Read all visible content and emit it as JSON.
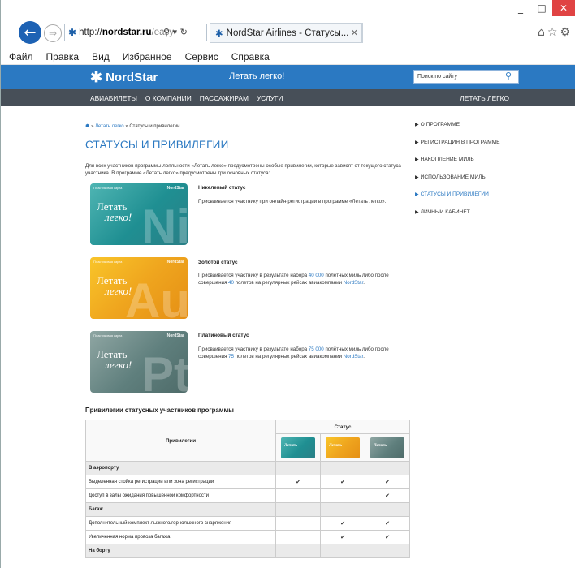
{
  "browser": {
    "url_prefix": "http://",
    "url_domain": "nordstar.ru",
    "url_rest": "/easy-",
    "tab_title": "NordStar Airlines - Статусы...",
    "window_controls": [
      "_",
      "□",
      "✕"
    ]
  },
  "menubar": [
    "Файл",
    "Правка",
    "Вид",
    "Избранное",
    "Сервис",
    "Справка"
  ],
  "header": {
    "logo": "NordStar",
    "slogan": "Летать легко!",
    "search_placeholder": "Поиск по сайту"
  },
  "nav": {
    "items": [
      "АВИАБИЛЕТЫ",
      "О КОМПАНИИ",
      "ПАССАЖИРАМ",
      "УСЛУГИ"
    ],
    "right": "ЛЕТАТЬ ЛЕГКО"
  },
  "breadcrumbs": {
    "sep": "»",
    "link": "Летать легко",
    "current": "Статусы и привилегии"
  },
  "title": "СТАТУСЫ И ПРИВИЛЕГИИ",
  "intro": "Для всех участников программы лояльности «Летать легко» предусмотрены особые привилегии, которые зависят от текущего статуса участника. В программе «Летать легко» предусмотрены три основных статуса:",
  "card_header": {
    "left": "Пластиковая карта",
    "brand": "NordStar",
    "site": "www.nordstar.ru"
  },
  "card_text": {
    "line1": "Летать",
    "line2": "легко!"
  },
  "statuses": [
    {
      "name": "Никелевый статус",
      "letters": "Ni",
      "desc_pre": "Присваивается участнику при онлайн-регистрации в программе «Летать легко».",
      "miles": "",
      "desc_mid": "",
      "flights": "",
      "desc_post": ""
    },
    {
      "name": "Золотой статус",
      "letters": "Au",
      "desc_pre": "Присваивается участнику в результате набора ",
      "miles": "40 000",
      "desc_mid": " полётных миль либо после совершения ",
      "flights": "40",
      "desc_post": " полетов на регулярных рейсах авиакомпании "
    },
    {
      "name": "Платиновый статус",
      "letters": "Pt",
      "desc_pre": "Присваивается участнику в результате набора ",
      "miles": "75 000",
      "desc_mid": " полётных миль либо после совершения ",
      "flights": "75",
      "desc_post": " полетов на регулярных рейсах авиакомпании "
    }
  ],
  "company": "NordStar",
  "sidebar": [
    {
      "label": "О ПРОГРАММЕ",
      "active": false
    },
    {
      "label": "РЕГИСТРАЦИЯ В ПРОГРАММЕ",
      "active": false
    },
    {
      "label": "НАКОПЛЕНИЕ МИЛЬ",
      "active": false
    },
    {
      "label": "ИСПОЛЬЗОВАНИЕ МИЛЬ",
      "active": false
    },
    {
      "label": "СТАТУСЫ И ПРИВИЛЕГИИ",
      "active": true
    },
    {
      "label": "ЛИЧНЫЙ КАБИНЕТ",
      "active": false
    }
  ],
  "privileges": {
    "heading": "Привилегии статусных участников программы",
    "col_privilege": "Привилегии",
    "col_status": "Статус",
    "check": "✔",
    "sections": [
      {
        "name": "В аэропорту",
        "rows": [
          {
            "label": "Выделенная стойка регистрации или зона регистрации",
            "checks": [
              true,
              true,
              true
            ]
          },
          {
            "label": "Доступ в залы ожидания повышенной комфортности",
            "checks": [
              false,
              false,
              true
            ]
          }
        ]
      },
      {
        "name": "Багаж",
        "rows": [
          {
            "label": "Дополнительный комплект лыжного/горнолыжного снаряжения",
            "checks": [
              false,
              true,
              true
            ]
          },
          {
            "label": "Увеличенная норма провоза багажа",
            "checks": [
              false,
              true,
              true
            ]
          }
        ]
      },
      {
        "name": "На борту",
        "rows": []
      }
    ]
  }
}
